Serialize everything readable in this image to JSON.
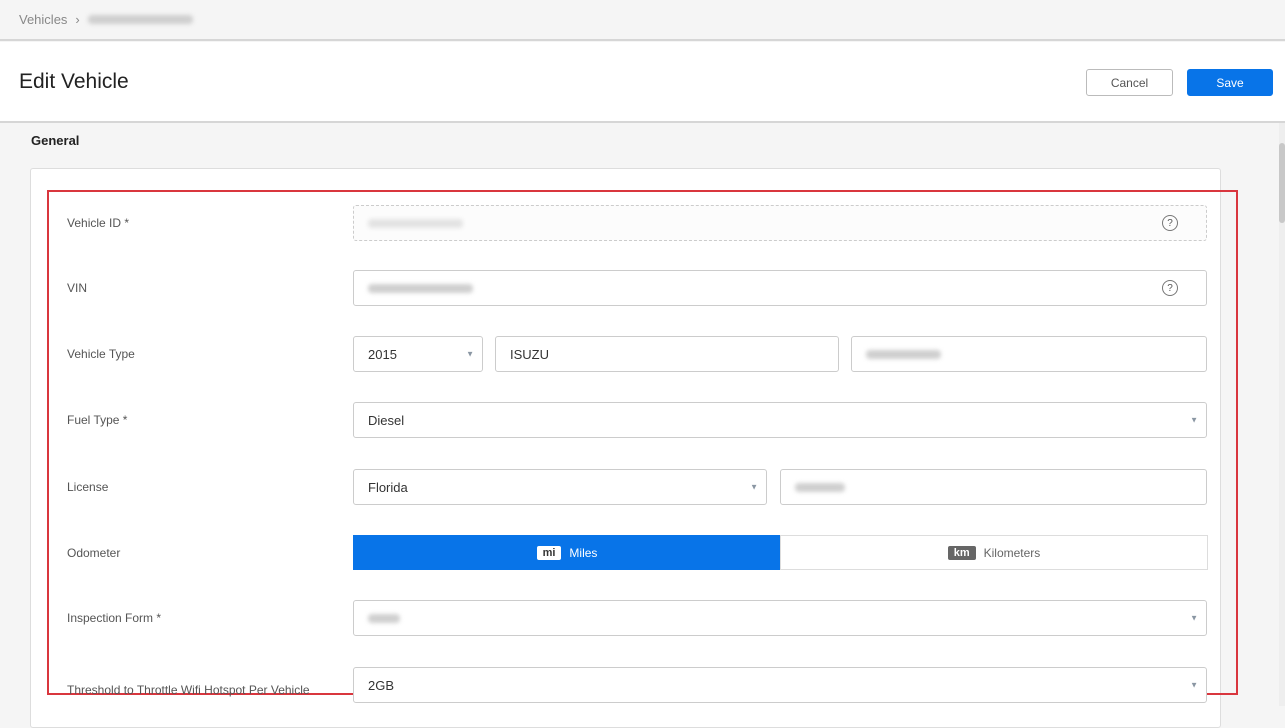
{
  "breadcrumb": {
    "root": "Vehicles",
    "separator": "›"
  },
  "header": {
    "title": "Edit Vehicle",
    "cancel": "Cancel",
    "save": "Save"
  },
  "section": "General",
  "form": {
    "vehicle_id_label": "Vehicle ID *",
    "vin_label": "VIN",
    "vehicle_type_label": "Vehicle Type",
    "year": "2015",
    "make": "ISUZU",
    "fuel_label": "Fuel Type *",
    "fuel": "Diesel",
    "license_label": "License",
    "state": "Florida",
    "odometer_label": "Odometer",
    "miles_badge": "mi",
    "miles": "Miles",
    "km_badge": "km",
    "km": "Kilometers",
    "odometer_selected": "Miles",
    "inspection_label": "Inspection Form *",
    "threshold_label": "Threshold to Throttle Wifi Hotspot Per Vehicle",
    "threshold": "2GB",
    "help_glyph": "?",
    "caret_glyph": "▼"
  },
  "colors": {
    "accent": "#0874e8",
    "highlight": "#d9363e"
  }
}
